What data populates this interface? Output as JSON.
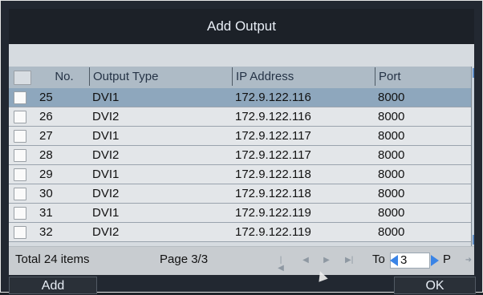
{
  "dialog": {
    "title": "Add Output"
  },
  "table": {
    "columns": [
      "No.",
      "Output Type",
      "IP Address",
      "Port"
    ],
    "rows": [
      {
        "no": "25",
        "type": "DVI1",
        "ip": "172.9.122.116",
        "port": "8000",
        "selected": true
      },
      {
        "no": "26",
        "type": "DVI2",
        "ip": "172.9.122.116",
        "port": "8000",
        "selected": false
      },
      {
        "no": "27",
        "type": "DVI1",
        "ip": "172.9.122.117",
        "port": "8000",
        "selected": false
      },
      {
        "no": "28",
        "type": "DVI2",
        "ip": "172.9.122.117",
        "port": "8000",
        "selected": false
      },
      {
        "no": "29",
        "type": "DVI1",
        "ip": "172.9.122.118",
        "port": "8000",
        "selected": false
      },
      {
        "no": "30",
        "type": "DVI2",
        "ip": "172.9.122.118",
        "port": "8000",
        "selected": false
      },
      {
        "no": "31",
        "type": "DVI1",
        "ip": "172.9.122.119",
        "port": "8000",
        "selected": false
      },
      {
        "no": "32",
        "type": "DVI2",
        "ip": "172.9.122.119",
        "port": "8000",
        "selected": false
      }
    ]
  },
  "pager": {
    "total": "Total 24 items",
    "page": "Page 3/3",
    "to_label": "To",
    "page_value": "3",
    "page_unit": "P"
  },
  "buttons": {
    "add": "Add",
    "ok": "OK"
  },
  "colors": {
    "accent": "#3a84e6",
    "selected_row": "#8ea7bd"
  }
}
